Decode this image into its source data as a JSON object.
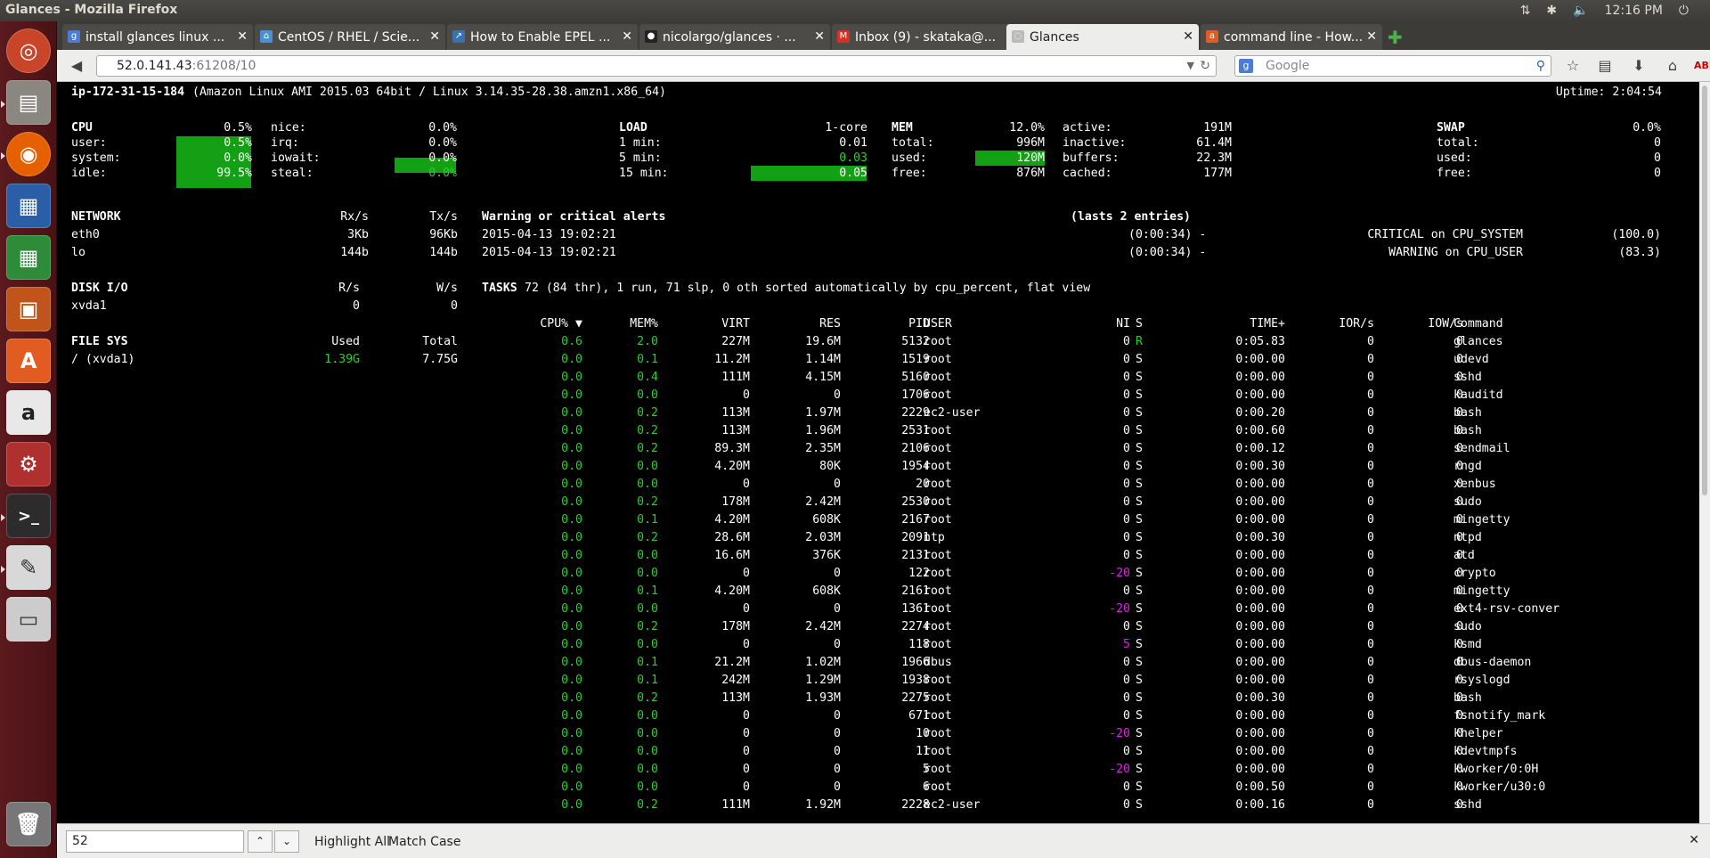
{
  "window": {
    "title": "Glances - Mozilla Firefox"
  },
  "tray": {
    "time": "12:16 PM"
  },
  "tabs": [
    {
      "label": "install glances linux ...",
      "favicon": "google"
    },
    {
      "label": "CentOS / RHEL / Scie...",
      "favicon": "site"
    },
    {
      "label": "How to Enable EPEL ...",
      "favicon": "site"
    },
    {
      "label": "nicolargo/glances · ...",
      "favicon": "github"
    },
    {
      "label": "Inbox (9) - skataka@...",
      "favicon": "gmail"
    },
    {
      "label": "Glances",
      "favicon": "globe",
      "active": true
    },
    {
      "label": "command line - How...",
      "favicon": "askubuntu"
    }
  ],
  "nav": {
    "url_host": "52.0.141.43",
    "url_rest": ":61208/10",
    "search_placeholder": "Google"
  },
  "glances": {
    "host": "ip-172-31-15-184",
    "system": "(Amazon Linux AMI 2015.03 64bit / Linux 3.14.35-28.38.amzn1.x86_64)",
    "uptime": "Uptime: 2:04:54",
    "cpu": {
      "title": "CPU",
      "total": "0.5%",
      "user_label": "user:",
      "user": "0.5%",
      "system_label": "system:",
      "system": "0.0%",
      "idle_label": "idle:",
      "idle": "99.5%",
      "nice_label": "nice:",
      "nice": "0.0%",
      "irq_label": "irq:",
      "irq": "0.0%",
      "iowait_label": "iowait:",
      "iowait": "0.0%",
      "steal_label": "steal:",
      "steal": "0.0%"
    },
    "load": {
      "title": "LOAD",
      "cores": "1-core",
      "min1_label": "1 min:",
      "min1": "0.01",
      "min5_label": "5 min:",
      "min5": "0.03",
      "min15_label": "15 min:",
      "min15": "0.05"
    },
    "mem": {
      "title": "MEM",
      "percent": "12.0%",
      "total_label": "total:",
      "total": "996M",
      "used_label": "used:",
      "used": "120M",
      "free_label": "free:",
      "free": "876M",
      "active_label": "active:",
      "active": "191M",
      "inactive_label": "inactive:",
      "inactive": "61.4M",
      "buffers_label": "buffers:",
      "buffers": "22.3M",
      "cached_label": "cached:",
      "cached": "177M"
    },
    "swap": {
      "title": "SWAP",
      "percent": "0.0%",
      "total_label": "total:",
      "total": "0",
      "used_label": "used:",
      "used": "0",
      "free_label": "free:",
      "free": "0"
    },
    "network": {
      "title": "NETWORK",
      "rx_label": "Rx/s",
      "tx_label": "Tx/s",
      "rows": [
        {
          "iface": "eth0",
          "rx": "3Kb",
          "tx": "96Kb"
        },
        {
          "iface": "lo",
          "rx": "144b",
          "tx": "144b"
        }
      ]
    },
    "diskio": {
      "title": "DISK I/O",
      "r_label": "R/s",
      "w_label": "W/s",
      "rows": [
        {
          "disk": "xvda1",
          "r": "0",
          "w": "0"
        }
      ]
    },
    "filesys": {
      "title": "FILE SYS",
      "used_label": "Used",
      "total_label": "Total",
      "rows": [
        {
          "mount": "/ (xvda1)",
          "used": "1.39G",
          "total": "7.75G"
        }
      ]
    },
    "alerts": {
      "title": "Warning or critical alerts",
      "count": "(lasts 2 entries)",
      "rows": [
        {
          "time": "2015-04-13 19:02:21",
          "duration": "(0:00:34) -",
          "msg": "CRITICAL on CPU_SYSTEM",
          "value": "(100.0)"
        },
        {
          "time": "2015-04-13 19:02:21",
          "duration": "(0:00:34) -",
          "msg": "WARNING on CPU_USER",
          "value": "(83.3)"
        }
      ]
    },
    "tasks": {
      "label": "TASKS",
      "summary": "72 (84 thr), 1 run, 71 slp, 0 oth sorted automatically by cpu_percent, flat view"
    },
    "proc_headers": {
      "cpu": "CPU% ▼",
      "mem": "MEM%",
      "virt": "VIRT",
      "res": "RES",
      "pid": "PID",
      "user": "USER",
      "ni": "NI",
      "s": "S",
      "time": "TIME+",
      "ior": "IOR/s",
      "iow": "IOW/s",
      "cmd": "Command"
    },
    "processes": [
      [
        "0.6",
        "2.0",
        "227M",
        "19.6M",
        "5132",
        "root",
        "0",
        "R",
        "0:05.83",
        "0",
        "0",
        "glances"
      ],
      [
        "0.0",
        "0.1",
        "11.2M",
        "1.14M",
        "1519",
        "root",
        "0",
        "S",
        "0:00.00",
        "0",
        "0",
        "udevd"
      ],
      [
        "0.0",
        "0.4",
        "111M",
        "4.15M",
        "5160",
        "root",
        "0",
        "S",
        "0:00.00",
        "0",
        "0",
        "sshd"
      ],
      [
        "0.0",
        "0.0",
        "0",
        "0",
        "1706",
        "root",
        "0",
        "S",
        "0:00.00",
        "0",
        "0",
        "kauditd"
      ],
      [
        "0.0",
        "0.2",
        "113M",
        "1.97M",
        "2229",
        "ec2-user",
        "0",
        "S",
        "0:00.20",
        "0",
        "0",
        "bash"
      ],
      [
        "0.0",
        "0.2",
        "113M",
        "1.96M",
        "2531",
        "root",
        "0",
        "S",
        "0:00.60",
        "0",
        "0",
        "bash"
      ],
      [
        "0.0",
        "0.2",
        "89.3M",
        "2.35M",
        "2106",
        "root",
        "0",
        "S",
        "0:00.12",
        "0",
        "0",
        "sendmail"
      ],
      [
        "0.0",
        "0.0",
        "4.20M",
        "80K",
        "1954",
        "root",
        "0",
        "S",
        "0:00.30",
        "0",
        "0",
        "rngd"
      ],
      [
        "0.0",
        "0.0",
        "0",
        "0",
        "20",
        "root",
        "0",
        "S",
        "0:00.00",
        "0",
        "0",
        "xenbus"
      ],
      [
        "0.0",
        "0.2",
        "178M",
        "2.42M",
        "2530",
        "root",
        "0",
        "S",
        "0:00.00",
        "0",
        "0",
        "sudo"
      ],
      [
        "0.0",
        "0.1",
        "4.20M",
        "608K",
        "2167",
        "root",
        "0",
        "S",
        "0:00.00",
        "0",
        "0",
        "mingetty"
      ],
      [
        "0.0",
        "0.2",
        "28.6M",
        "2.03M",
        "2091",
        "ntp",
        "0",
        "S",
        "0:00.30",
        "0",
        "0",
        "ntpd"
      ],
      [
        "0.0",
        "0.0",
        "16.6M",
        "376K",
        "2131",
        "root",
        "0",
        "S",
        "0:00.00",
        "0",
        "0",
        "atd"
      ],
      [
        "0.0",
        "0.0",
        "0",
        "0",
        "122",
        "root",
        "-20",
        "S",
        "0:00.00",
        "0",
        "0",
        "crypto"
      ],
      [
        "0.0",
        "0.1",
        "4.20M",
        "608K",
        "2161",
        "root",
        "0",
        "S",
        "0:00.00",
        "0",
        "0",
        "mingetty"
      ],
      [
        "0.0",
        "0.0",
        "0",
        "0",
        "1361",
        "root",
        "-20",
        "S",
        "0:00.00",
        "0",
        "0",
        "ext4-rsv-conver"
      ],
      [
        "0.0",
        "0.2",
        "178M",
        "2.42M",
        "2274",
        "root",
        "0",
        "S",
        "0:00.00",
        "0",
        "0",
        "sudo"
      ],
      [
        "0.0",
        "0.0",
        "0",
        "0",
        "118",
        "root",
        "5",
        "S",
        "0:00.00",
        "0",
        "0",
        "ksmd"
      ],
      [
        "0.0",
        "0.1",
        "21.2M",
        "1.02M",
        "1966",
        "dbus",
        "0",
        "S",
        "0:00.00",
        "0",
        "0",
        "dbus-daemon"
      ],
      [
        "0.0",
        "0.1",
        "242M",
        "1.29M",
        "1938",
        "root",
        "0",
        "S",
        "0:00.00",
        "0",
        "0",
        "rsyslogd"
      ],
      [
        "0.0",
        "0.2",
        "113M",
        "1.93M",
        "2275",
        "root",
        "0",
        "S",
        "0:00.30",
        "0",
        "0",
        "bash"
      ],
      [
        "0.0",
        "0.0",
        "0",
        "0",
        "671",
        "root",
        "0",
        "S",
        "0:00.00",
        "0",
        "0",
        "fsnotify_mark"
      ],
      [
        "0.0",
        "0.0",
        "0",
        "0",
        "10",
        "root",
        "-20",
        "S",
        "0:00.00",
        "0",
        "0",
        "khelper"
      ],
      [
        "0.0",
        "0.0",
        "0",
        "0",
        "11",
        "root",
        "0",
        "S",
        "0:00.00",
        "0",
        "0",
        "kdevtmpfs"
      ],
      [
        "0.0",
        "0.0",
        "0",
        "0",
        "5",
        "root",
        "-20",
        "S",
        "0:00.00",
        "0",
        "0",
        "kworker/0:0H"
      ],
      [
        "0.0",
        "0.0",
        "0",
        "0",
        "6",
        "root",
        "0",
        "S",
        "0:00.50",
        "0",
        "0",
        "kworker/u30:0"
      ],
      [
        "0.0",
        "0.2",
        "111M",
        "1.92M",
        "2228",
        "ec2-user",
        "0",
        "S",
        "0:00.16",
        "0",
        "0",
        "sshd"
      ]
    ]
  },
  "findbar": {
    "query": "52",
    "highlight_all": "Highlight All",
    "match_case": "Match Case"
  },
  "colors": {
    "green": "#2ecc2e",
    "bar_green": "#14a014",
    "magenta": "#e020e0"
  }
}
